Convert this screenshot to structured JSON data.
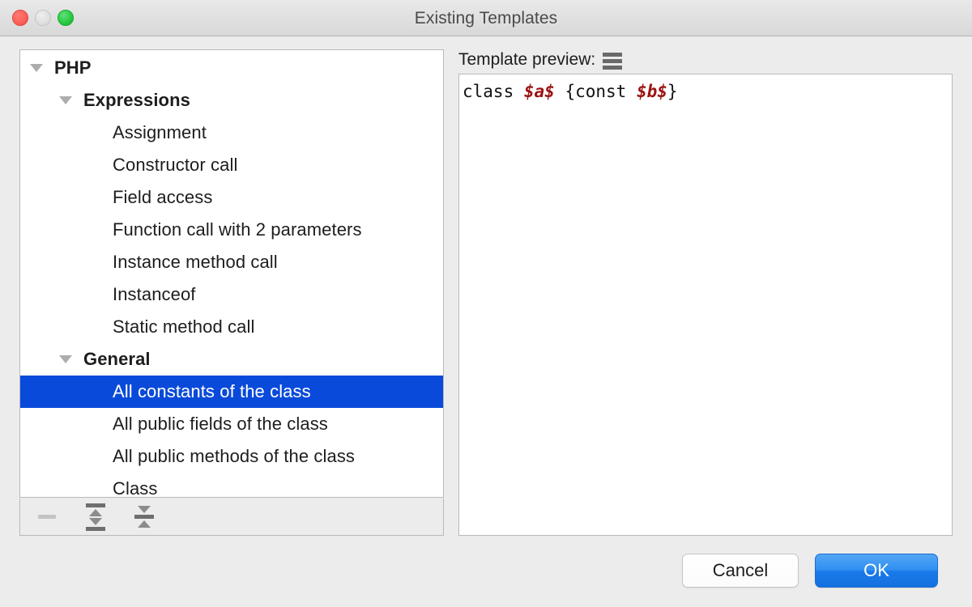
{
  "window": {
    "title": "Existing Templates",
    "traffic_lights": [
      "close-button",
      "minimize-button",
      "zoom-button"
    ]
  },
  "tree": {
    "rows": [
      {
        "label": "PHP",
        "level": 0,
        "group": true,
        "expanded": true,
        "selected": false
      },
      {
        "label": "Expressions",
        "level": 1,
        "group": true,
        "expanded": true,
        "selected": false
      },
      {
        "label": "Assignment",
        "level": 2,
        "group": false,
        "expanded": false,
        "selected": false
      },
      {
        "label": "Constructor call",
        "level": 2,
        "group": false,
        "expanded": false,
        "selected": false
      },
      {
        "label": "Field access",
        "level": 2,
        "group": false,
        "expanded": false,
        "selected": false
      },
      {
        "label": "Function call with 2 parameters",
        "level": 2,
        "group": false,
        "expanded": false,
        "selected": false
      },
      {
        "label": "Instance method call",
        "level": 2,
        "group": false,
        "expanded": false,
        "selected": false
      },
      {
        "label": "Instanceof",
        "level": 2,
        "group": false,
        "expanded": false,
        "selected": false
      },
      {
        "label": "Static method call",
        "level": 2,
        "group": false,
        "expanded": false,
        "selected": false
      },
      {
        "label": "General",
        "level": 1,
        "group": true,
        "expanded": true,
        "selected": false
      },
      {
        "label": "All constants of the class",
        "level": 2,
        "group": false,
        "expanded": false,
        "selected": true
      },
      {
        "label": "All public fields of the class",
        "level": 2,
        "group": false,
        "expanded": false,
        "selected": false
      },
      {
        "label": "All public methods of the class",
        "level": 2,
        "group": false,
        "expanded": false,
        "selected": false
      },
      {
        "label": "Class",
        "level": 2,
        "group": false,
        "expanded": false,
        "selected": false
      }
    ],
    "selection_color": "#0a4ada",
    "toolbar": {
      "remove_label": "minus-icon",
      "expand_all_label": "expand-all-icon",
      "collapse_all_label": "collapse-all-icon"
    }
  },
  "preview": {
    "header_label": "Template preview:",
    "menu_icon": "hamburger-menu-icon",
    "code": {
      "segments": [
        {
          "text": "class ",
          "variable": false
        },
        {
          "text": "$a$",
          "variable": true
        },
        {
          "text": " {const ",
          "variable": false
        },
        {
          "text": "$b$",
          "variable": true
        },
        {
          "text": "}",
          "variable": false
        }
      ],
      "plain_text": "class $a$ {const $b$}",
      "variable_color": "#9b1212"
    }
  },
  "footer": {
    "cancel_label": "Cancel",
    "ok_label": "OK",
    "ok_accent_color": "#1a7ae9"
  }
}
